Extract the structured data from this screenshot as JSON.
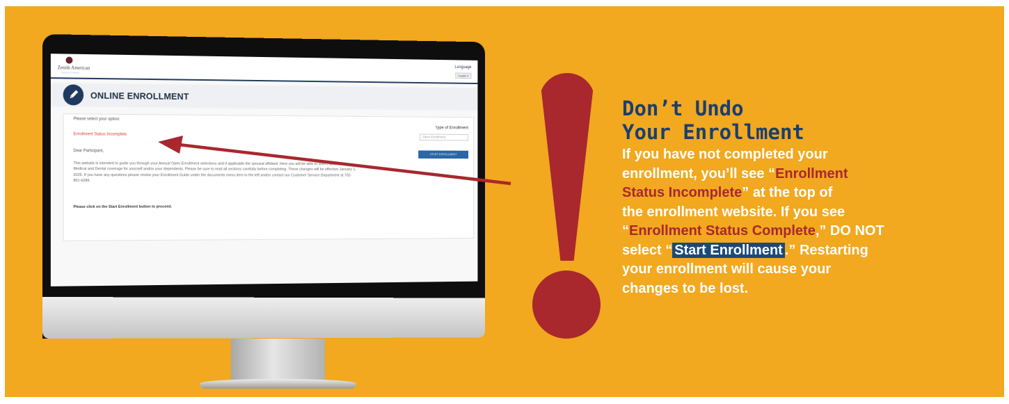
{
  "screen": {
    "brand_name": "Zenith American",
    "brand_subline": "SOLUTIONS",
    "language_label": "Language",
    "language_value": "English",
    "page_title": "ONLINE ENROLLMENT",
    "select_option_text": "Please select your option:",
    "status_text": "Enrollment Status Incomplete",
    "greeting": "Dear Participant,",
    "body_text": "This website is intended to guide you through your Annual Open Enrollment selections and if applicable the spousal affidavit. Here you will be able to select options for Medical and Dental coverage for yourself and/or your dependents. Please be sure to read all sections carefully before completing. These changes will be effective January 1, 2025. If you have any questions please review your Enrollment Guide under the documents menu item to the left and/or contact our Customer Service Department at 702-851-6286.",
    "proceed_text": "Please click on the Start Enrollment button to proceed.",
    "type_label": "Type of Enrollment",
    "type_value": "Open Enrollment",
    "start_button": "START ENROLLMENT"
  },
  "headline": {
    "line1": "Don’t Undo",
    "line2": "Your Enrollment"
  },
  "message": {
    "l1": "If you have not completed your",
    "l2_pre": "enrollment, you’ll see “",
    "l2_red": "Enrollment",
    "l3_red": "Status Incomplete",
    "l3_post": "” at the top of",
    "l4": "the enrollment website. If you see",
    "l5_open": "“",
    "l5_red": "Enrollment Status Complete",
    "l5_post": ",” DO NOT",
    "l6_pre": "select “",
    "l6_hl": "Start Enrollment",
    "l6_post": ".” Restarting",
    "l7": "your enrollment will cause your",
    "l8": "changes to be lost."
  },
  "colors": {
    "background": "#f2a81f",
    "accent_red": "#a8282e",
    "headline_blue": "#1a3f6f",
    "highlight_blue": "#1a4a7a"
  }
}
